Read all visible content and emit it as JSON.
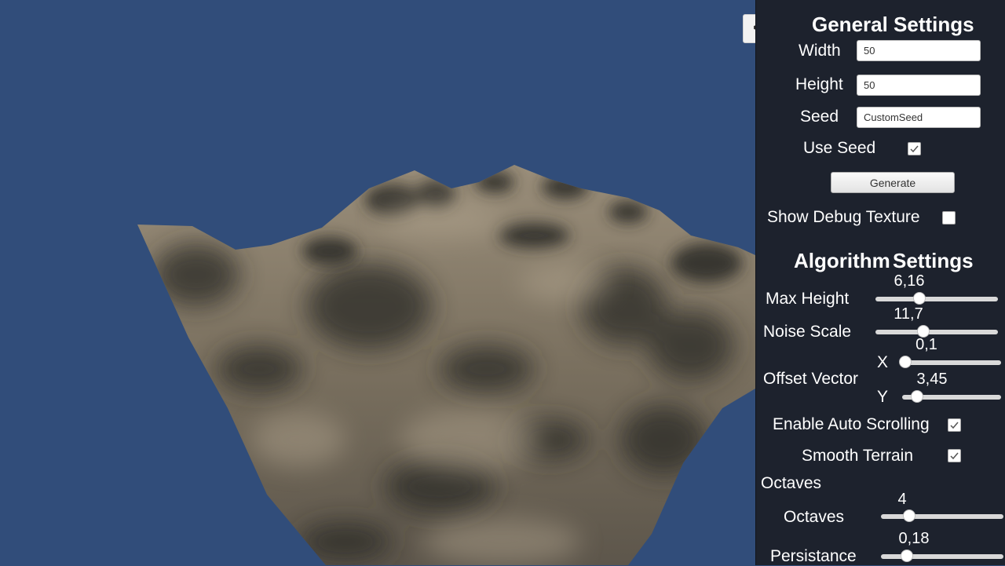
{
  "collapse_button": {
    "label": "<"
  },
  "general": {
    "title": "General Settings",
    "width": {
      "label": "Width",
      "value": "50"
    },
    "height": {
      "label": "Height",
      "value": "50"
    },
    "seed": {
      "label": "Seed",
      "value": "CustomSeed"
    },
    "use_seed": {
      "label": "Use Seed",
      "checked": true
    },
    "generate_label": "Generate",
    "show_debug_texture": {
      "label": "Show Debug Texture",
      "checked": false
    }
  },
  "algorithm": {
    "title_word1": "Algorithm",
    "title_word2": "Settings",
    "max_height": {
      "label": "Max Height",
      "value": "6,16",
      "fraction": 0.36
    },
    "noise_scale": {
      "label": "Noise Scale",
      "value": "11,7",
      "fraction": 0.39
    },
    "offset_vector": {
      "label": "Offset Vector",
      "x": {
        "label": "X",
        "value": "0,1",
        "fraction": 0.03
      },
      "y": {
        "label": "Y",
        "value": "3,45",
        "fraction": 0.15
      }
    },
    "enable_auto_scrolling": {
      "label": "Enable Auto Scrolling",
      "checked": true
    },
    "smooth_terrain": {
      "label": "Smooth Terrain",
      "checked": true
    },
    "octaves_header": "Octaves",
    "octaves": {
      "label": "Octaves",
      "value": "4",
      "fraction": 0.23
    },
    "persistance": {
      "label": "Persistance",
      "value": "0,18",
      "fraction": 0.21
    }
  },
  "colors": {
    "sky": "#314d7a",
    "panel": "#1d222d",
    "terrain_light": "#8e8270",
    "terrain_dark": "#2c2a28"
  }
}
